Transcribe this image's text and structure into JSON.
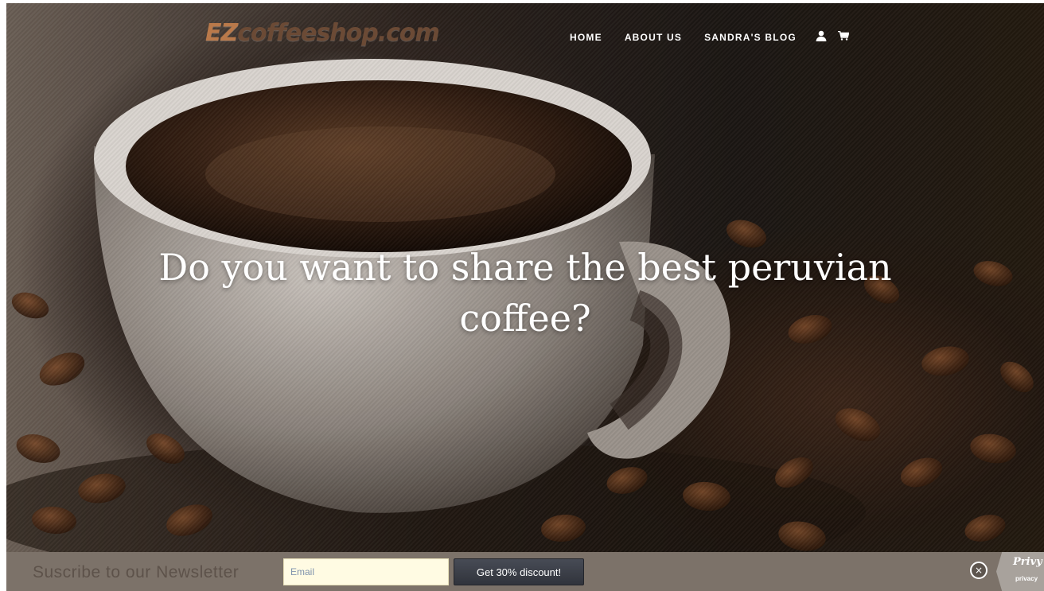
{
  "header": {
    "logo_ez": "EZ",
    "logo_rest": "coffeeshop.com",
    "nav": [
      "HOME",
      "ABOUT US",
      "SANDRA'S BLOG"
    ],
    "icons": [
      "user-icon",
      "cart-icon"
    ]
  },
  "hero": {
    "headline_line1": "Do you want to share the best peruvian",
    "headline_line2": "coffee?"
  },
  "newsletter": {
    "title": "Suscribe to our Newsletter",
    "email_placeholder": "Email",
    "button_label": "Get 30% discount!",
    "close_icon": "×",
    "privy_logo": "Privy",
    "privy_text": "privacy"
  },
  "colors": {
    "accent_orange": "#b9794a",
    "logo_brown": "#6b4a35",
    "newsbar_bg": "#7c7269",
    "email_bg": "#fffbe3",
    "button_bg": "#3a3d45"
  }
}
